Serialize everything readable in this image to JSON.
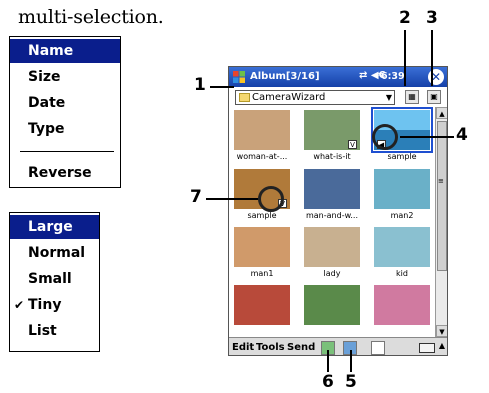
{
  "heading": "multi-selection.",
  "sort_menu": {
    "items": [
      "Name",
      "Size",
      "Date",
      "Type",
      "Reverse"
    ],
    "selected": "Name"
  },
  "view_menu": {
    "items": [
      "Large",
      "Normal",
      "Small",
      "Tiny",
      "List"
    ],
    "highlighted": "Large",
    "checked": "Tiny"
  },
  "pda": {
    "title": "Album[3/16]",
    "clock": "6:39",
    "status_icons": "⇄ ◀€",
    "folder": "CameraWizard",
    "thumbnails": [
      {
        "caption": "woman-at-...",
        "color": "#c9a27a",
        "badge": ""
      },
      {
        "caption": "what-is-it",
        "color": "#7a9a6a",
        "badge": "V"
      },
      {
        "caption": "sample",
        "color": "#4aa0d8",
        "badge": "◀"
      },
      {
        "caption": "sample",
        "color": "#b07a3a",
        "badge": "V"
      },
      {
        "caption": "man-and-w...",
        "color": "#4a6a9a",
        "badge": ""
      },
      {
        "caption": "man2",
        "color": "#6ab0c8",
        "badge": ""
      },
      {
        "caption": "man1",
        "color": "#d09a6a",
        "badge": ""
      },
      {
        "caption": "lady",
        "color": "#c8b090",
        "badge": ""
      },
      {
        "caption": "kid",
        "color": "#8ac0d0",
        "badge": ""
      },
      {
        "caption": "",
        "color": "#b84a3a",
        "badge": ""
      },
      {
        "caption": "",
        "color": "#5a8a4a",
        "badge": ""
      },
      {
        "caption": "",
        "color": "#d07aa0",
        "badge": ""
      }
    ],
    "menu": {
      "edit": "Edit",
      "tools": "Tools",
      "send": "Send"
    }
  },
  "callouts": [
    "1",
    "2",
    "3",
    "4",
    "5",
    "6",
    "7"
  ]
}
